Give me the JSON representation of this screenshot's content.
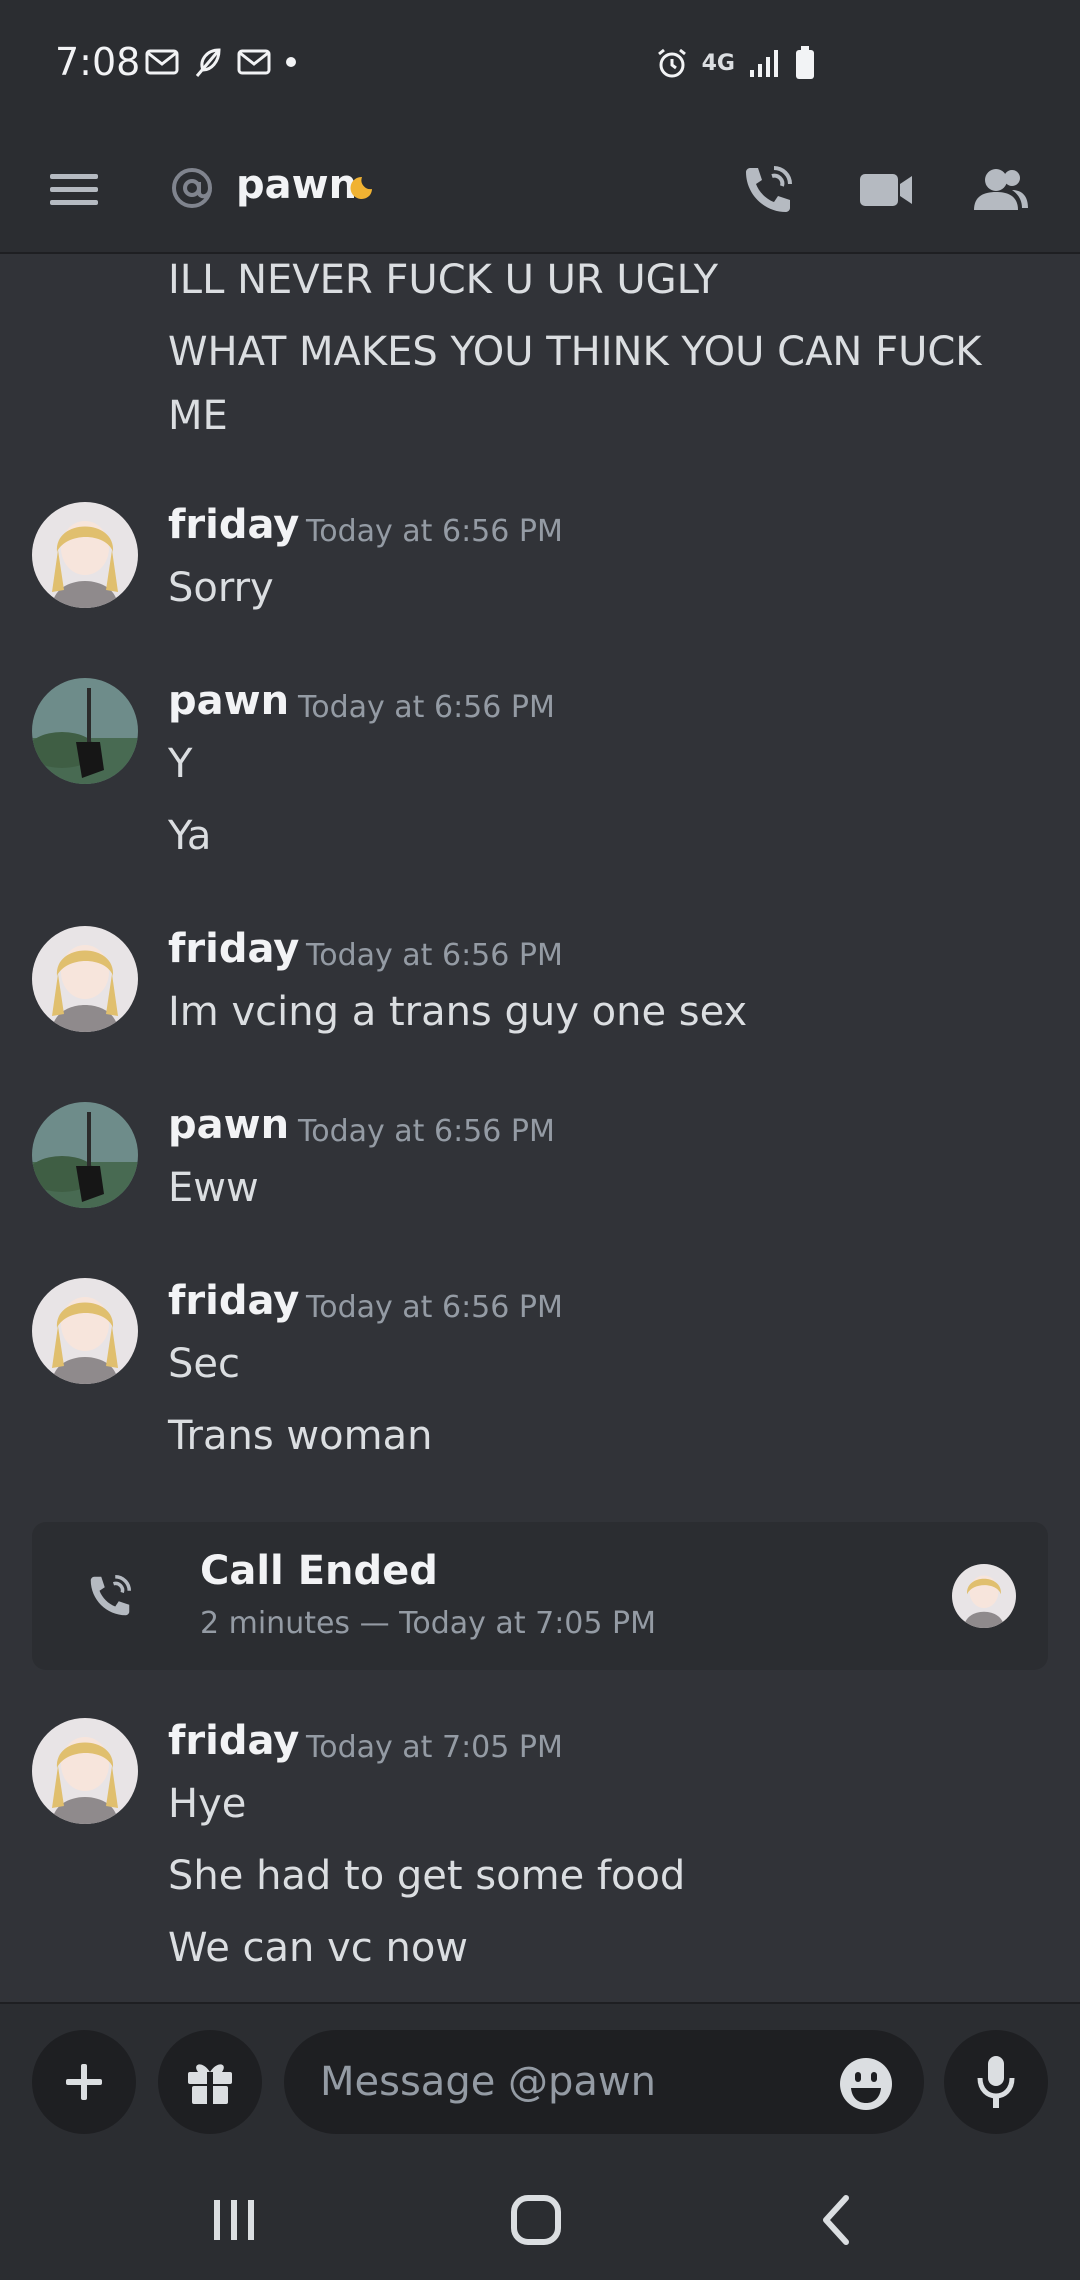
{
  "status_bar": {
    "time": "7:08",
    "network": "4G"
  },
  "header": {
    "channel": "pawn"
  },
  "messages": {
    "top_lines": [
      "ILL NEVER FUCK U UR UGLY",
      "WHAT MAKES YOU THINK YOU CAN FUCK",
      "ME"
    ],
    "groups": [
      {
        "author": "friday",
        "time": "Today at 6:56 PM",
        "lines": [
          "Sorry"
        ]
      },
      {
        "author": "pawn",
        "time": "Today at 6:56 PM",
        "lines": [
          "Y",
          "Ya"
        ]
      },
      {
        "author": "friday",
        "time": "Today at 6:56 PM",
        "lines": [
          "Im vcing a trans guy one sex"
        ]
      },
      {
        "author": "pawn",
        "time": "Today at 6:56 PM",
        "lines": [
          "Eww"
        ]
      },
      {
        "author": "friday",
        "time": "Today at 6:56 PM",
        "lines": [
          "Sec",
          "Trans woman"
        ]
      },
      {
        "author": "friday",
        "time": "Today at 7:05 PM",
        "lines": [
          "Hye",
          "She had to get some food",
          "We can vc now"
        ]
      }
    ]
  },
  "call": {
    "title": "Call Ended",
    "subtitle": "2 minutes — Today at 7:05 PM"
  },
  "composer": {
    "placeholder": "Message @pawn"
  },
  "icons": {
    "menu": "hamburger-icon",
    "at": "at-icon",
    "status": "idle-moon-icon",
    "call": "phone-call-icon",
    "video": "video-camera-icon",
    "members": "members-icon",
    "add": "plus-icon",
    "gift": "gift-icon",
    "emoji": "emoji-icon",
    "mic": "microphone-icon"
  },
  "colors": {
    "background": "#313338",
    "header": "#2b2d31",
    "input": "#1e1f22",
    "muted_text": "#949ba4",
    "idle_status": "#f0b232"
  }
}
